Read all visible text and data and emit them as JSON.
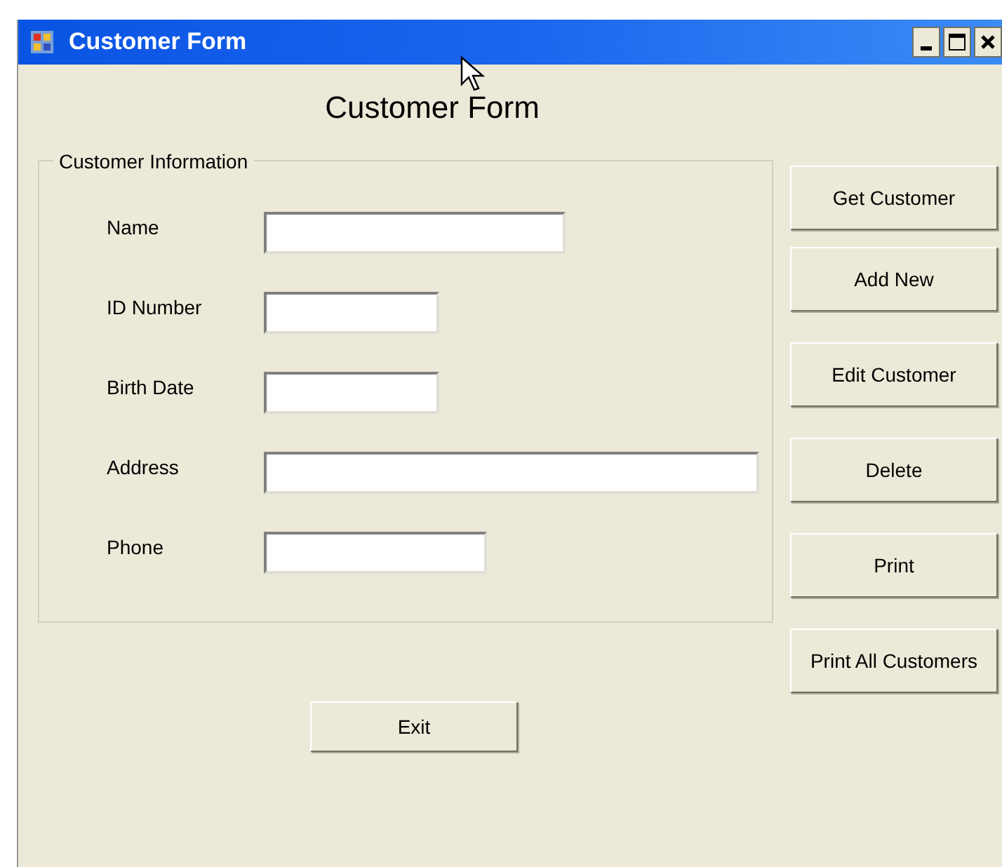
{
  "window": {
    "title": "Customer Form"
  },
  "heading": "Customer Form",
  "group": {
    "title": "Customer Information",
    "fields": [
      {
        "label": "Name"
      },
      {
        "label": "ID Number"
      },
      {
        "label": "Birth Date"
      },
      {
        "label": "Address"
      },
      {
        "label": "Phone"
      }
    ]
  },
  "actions": [
    "Get Customer",
    "Add New",
    "Edit Customer",
    "Delete",
    "Print",
    "Print All Customers"
  ],
  "exit_button": "Exit"
}
